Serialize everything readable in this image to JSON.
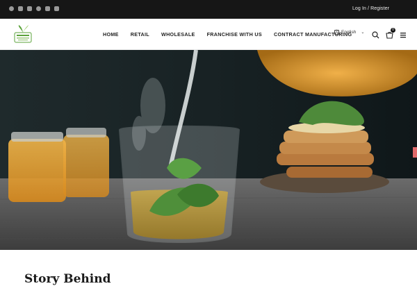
{
  "topbar": {
    "social_icons": [
      "facebook-icon",
      "twitter-icon",
      "linkedin-icon",
      "instagram-icon",
      "youtube-icon",
      "play-icon"
    ],
    "login_label": "Log In / Register"
  },
  "navbar": {
    "logo_alt": "Tea Leaf Logo",
    "items": [
      "HOME",
      "RETAIL",
      "WHOLESALE",
      "FRANCHISE WITH US",
      "CONTRACT MANUFACTURING"
    ],
    "language": "English",
    "cart_count": "0"
  },
  "hero": {
    "image_description": "Hot tea being poured into a glass cup with mint leaves, honey jars and pancakes in background"
  },
  "section": {
    "heading": "Story Behind"
  }
}
